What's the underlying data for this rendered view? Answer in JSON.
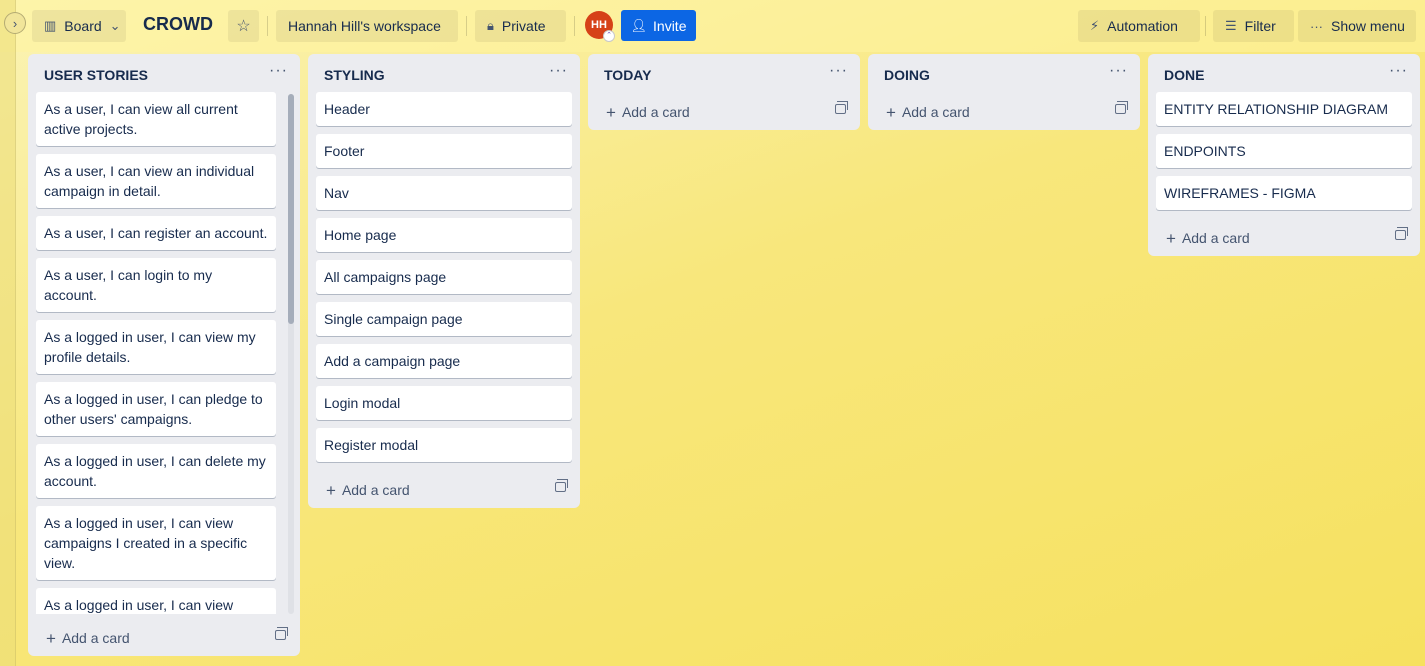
{
  "header": {
    "view_label": "Board",
    "board_title": "CROWD",
    "workspace_label": "Hannah Hill's workspace",
    "visibility_label": "Private",
    "avatar_initials": "HH",
    "invite_label": "Invite",
    "automation_label": "Automation",
    "filter_label": "Filter",
    "menu_label": "Show menu"
  },
  "add_card_label": "Add a card",
  "lists": [
    {
      "title": "USER STORIES",
      "cards": [
        "As a user, I can view all current active projects.",
        "As a user, I can view an individual campaign in detail.",
        "As a user, I can register an account.",
        "As a user, I can login to my account.",
        "As a logged in user, I can view my profile details.",
        "As a logged in user, I can pledge to other users' campaigns.",
        "As a logged in user, I can delete my account.",
        "As a logged in user, I can view campaigns I created in a specific view.",
        "As a logged in user, I can view"
      ]
    },
    {
      "title": "STYLING",
      "cards": [
        "Header",
        "Footer",
        "Nav",
        "Home page",
        "All campaigns page",
        "Single campaign page",
        "Add a campaign page",
        "Login modal",
        "Register modal"
      ]
    },
    {
      "title": "TODAY",
      "cards": []
    },
    {
      "title": "DOING",
      "cards": []
    },
    {
      "title": "DONE",
      "cards": [
        "ENTITY RELATIONSHIP DIAGRAM",
        "ENDPOINTS",
        "WIREFRAMES - FIGMA"
      ]
    }
  ],
  "colors": {
    "invite_bg": "#0c66e4",
    "avatar_bg": "#d64117",
    "list_bg": "#ebecf0",
    "board_bg": "#f8e77c"
  }
}
